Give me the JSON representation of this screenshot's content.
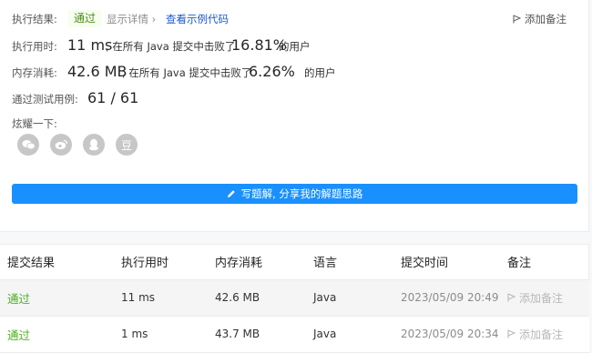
{
  "summary": {
    "result_label": "执行结果:",
    "result_value": "通过",
    "show_details": "显示详情",
    "show_details_arrow": "›",
    "view_example": "查看示例代码",
    "add_note": "添加备注",
    "runtime_label": "执行用时:",
    "runtime_value": "11 ms",
    "runtime_mid": ", 在所有 Java 提交中击败了",
    "runtime_percent": "16.81%",
    "runtime_suffix": "的用户",
    "memory_label": "内存消耗:",
    "memory_value": "42.6 MB",
    "memory_mid": ", 在所有 Java 提交中击败了",
    "memory_percent": "6.26%",
    "memory_suffix": "的用户",
    "tests_label": "通过测试用例:",
    "tests_value": "61 / 61",
    "share_label": "炫耀一下:",
    "share_icons": [
      "wechat-icon",
      "weibo-icon",
      "qq-icon",
      "douban-icon"
    ],
    "douban_glyph": "豆",
    "write_button": "写题解, 分享我的解题思路"
  },
  "table": {
    "headers": [
      "提交结果",
      "执行用时",
      "内存消耗",
      "语言",
      "提交时间",
      "备注"
    ],
    "rows": [
      {
        "result": "通过",
        "runtime": "11 ms",
        "memory": "42.6 MB",
        "language": "Java",
        "time": "2023/05/09 20:49",
        "note": "添加备注"
      },
      {
        "result": "通过",
        "runtime": "1 ms",
        "memory": "43.7 MB",
        "language": "Java",
        "time": "2023/05/09 20:34",
        "note": "添加备注"
      }
    ]
  },
  "colors": {
    "pass_green": "#4caf22",
    "link_blue": "#1a59d6",
    "button_blue": "#1a90ff",
    "share_gray": "#c7c7c7"
  }
}
